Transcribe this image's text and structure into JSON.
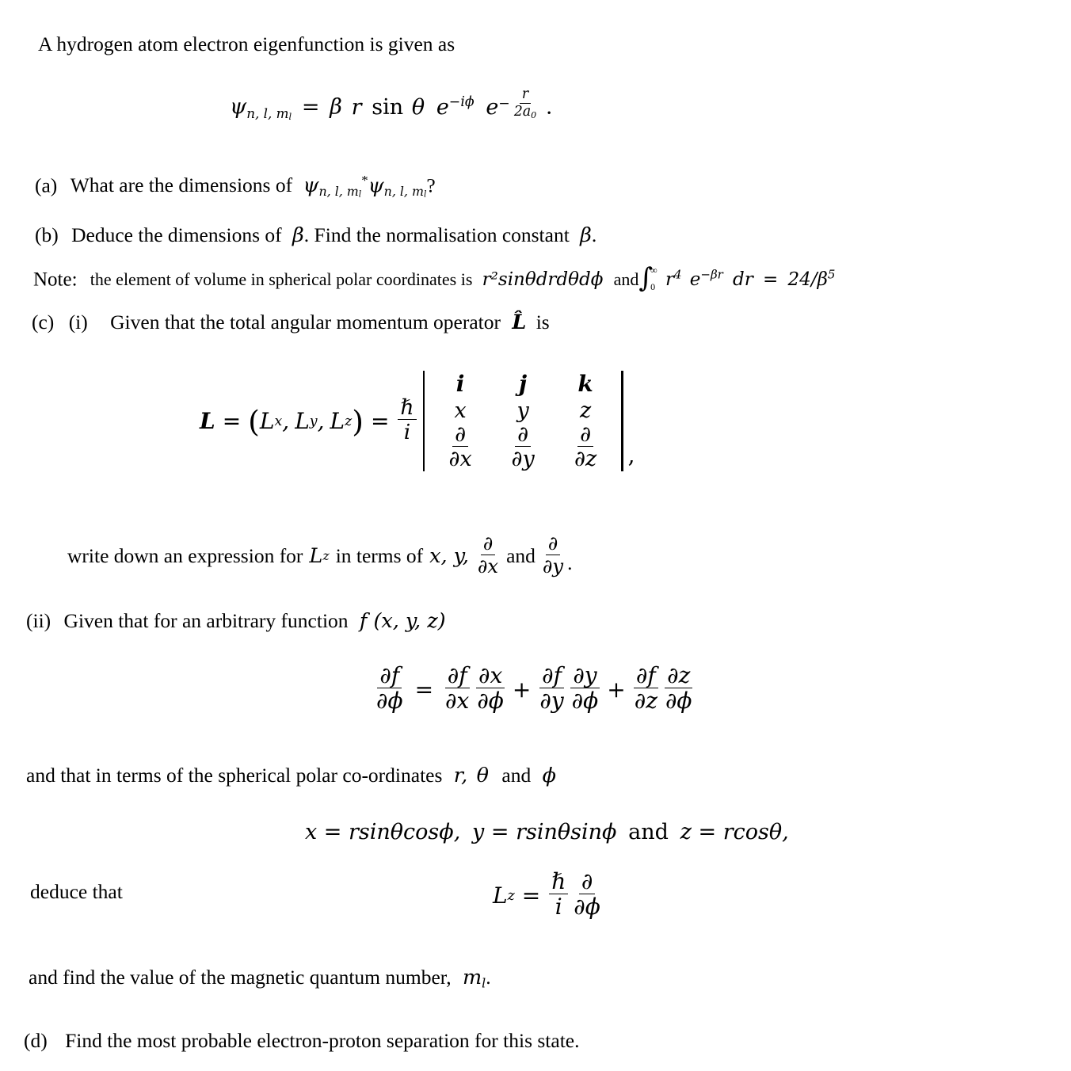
{
  "document": {
    "type": "exam-question",
    "subject": "quantum-mechanics-hydrogen-atom",
    "intro": "A hydrogen atom electron eigenfunction is given as",
    "eigenfunction": {
      "lhs_psi": "ψ",
      "lhs_sub": "n, l, m",
      "lhs_sub_sub": "l",
      "equals": "=",
      "beta": "β",
      "r": "r",
      "sin": "sin",
      "theta": "θ",
      "e1": "e",
      "e1_exp": "−iϕ",
      "e2": "e",
      "e2_exp_minus": "−",
      "e2_num": "r",
      "e2_den_2": "2a",
      "e2_den_sub": "0",
      "period": "."
    },
    "parts": [
      {
        "label": "(a)",
        "text_before": "What are the dimensions of",
        "psi1": "ψ",
        "psi1_sub": "n, l, m",
        "psi1_sub_sub": "l",
        "star": "*",
        "psi2": "ψ",
        "psi2_sub": "n, l, m",
        "psi2_sub_sub": "l",
        "question_mark": "?"
      },
      {
        "label": "(b)",
        "text_1": "Deduce the dimensions of",
        "beta": "β",
        "text_2": ".  Find the normalisation constant",
        "beta2": "β",
        "period": "."
      }
    ],
    "note": {
      "label": "Note:",
      "text_1": "the element of volume in spherical polar coordinates is",
      "volume_element": "r²sinθdrdθdϕ",
      "and_1": "and",
      "integral_symbol": "∫",
      "integral_upper": "∞",
      "integral_lower": "0",
      "integrand_r": "r",
      "integrand_r_exp": "4",
      "integrand_e": "e",
      "integrand_e_exp": "−βr",
      "dr": "dr",
      "equals": "=",
      "result_num": "24/β",
      "result_exp": "5"
    },
    "part_c": {
      "label": "(c)",
      "roman_i": "(i)",
      "text": "Given that the total angular momentum operator",
      "operator": "L̂",
      "is": "is"
    },
    "determinant": {
      "L": "L",
      "equals_1": "=",
      "open_paren": "(",
      "Lx": "L",
      "Lx_sub": "x",
      "comma1": ",",
      "Ly": "L",
      "Ly_sub": "y",
      "comma2": ",",
      "Lz": "L",
      "Lz_sub": "z",
      "close_paren": ")",
      "equals_2": "=",
      "hbar": "ℏ",
      "i_den": "i",
      "row_headers": [
        "i",
        "j",
        "k"
      ],
      "row_coords": [
        "x",
        "y",
        "z"
      ],
      "row_partials_num": [
        "∂",
        "∂",
        "∂"
      ],
      "row_partials_den": [
        "∂x",
        "∂y",
        "∂z"
      ],
      "trailing_comma": ","
    },
    "write_down": {
      "text_1": "write down an expression for",
      "Lz": "L",
      "Lz_sub": "z",
      "text_2": "in terms of",
      "vars": "x, y,",
      "frac1_num": "∂",
      "frac1_den": "∂x",
      "and": "and",
      "frac2_num": "∂",
      "frac2_den": "∂y",
      "period": "."
    },
    "part_c_ii": {
      "label": "(ii)",
      "text": "Given that for an arbitrary function",
      "function": "f (x, y, z)"
    },
    "chain_rule": {
      "lhs_num": "∂f",
      "lhs_den": "∂ϕ",
      "equals": "=",
      "t1a_num": "∂f",
      "t1a_den": "∂x",
      "t1b_num": "∂x",
      "t1b_den": "∂ϕ",
      "plus1": "+",
      "t2a_num": "∂f",
      "t2a_den": "∂y",
      "t2b_num": "∂y",
      "t2b_den": "∂ϕ",
      "plus2": "+",
      "t3a_num": "∂f",
      "t3a_den": "∂z",
      "t3b_num": "∂z",
      "t3b_den": "∂ϕ"
    },
    "spherical_intro": {
      "text_1": "and that in terms of the spherical polar co-ordinates",
      "r": "r,",
      "theta": "θ",
      "and": "and",
      "phi": "ϕ"
    },
    "spherical_transforms": {
      "x_eq": "x = rsinθcosϕ,",
      "y_eq": "y = rsinθsinϕ",
      "and": "and",
      "z_eq": "z = rcosθ,"
    },
    "deduce": {
      "text": "deduce that",
      "Lz": "L",
      "Lz_sub": "z",
      "equals": "=",
      "hbar": "ℏ",
      "i": "i",
      "partial_num": "∂",
      "partial_den": "∂ϕ"
    },
    "find_ml": {
      "text": "and find the value of the magnetic quantum number,",
      "ml": "m",
      "ml_sub": "l",
      "period": "."
    },
    "part_d": {
      "label": "(d)",
      "text": "Find the most probable electron-proton separation for this state."
    }
  }
}
